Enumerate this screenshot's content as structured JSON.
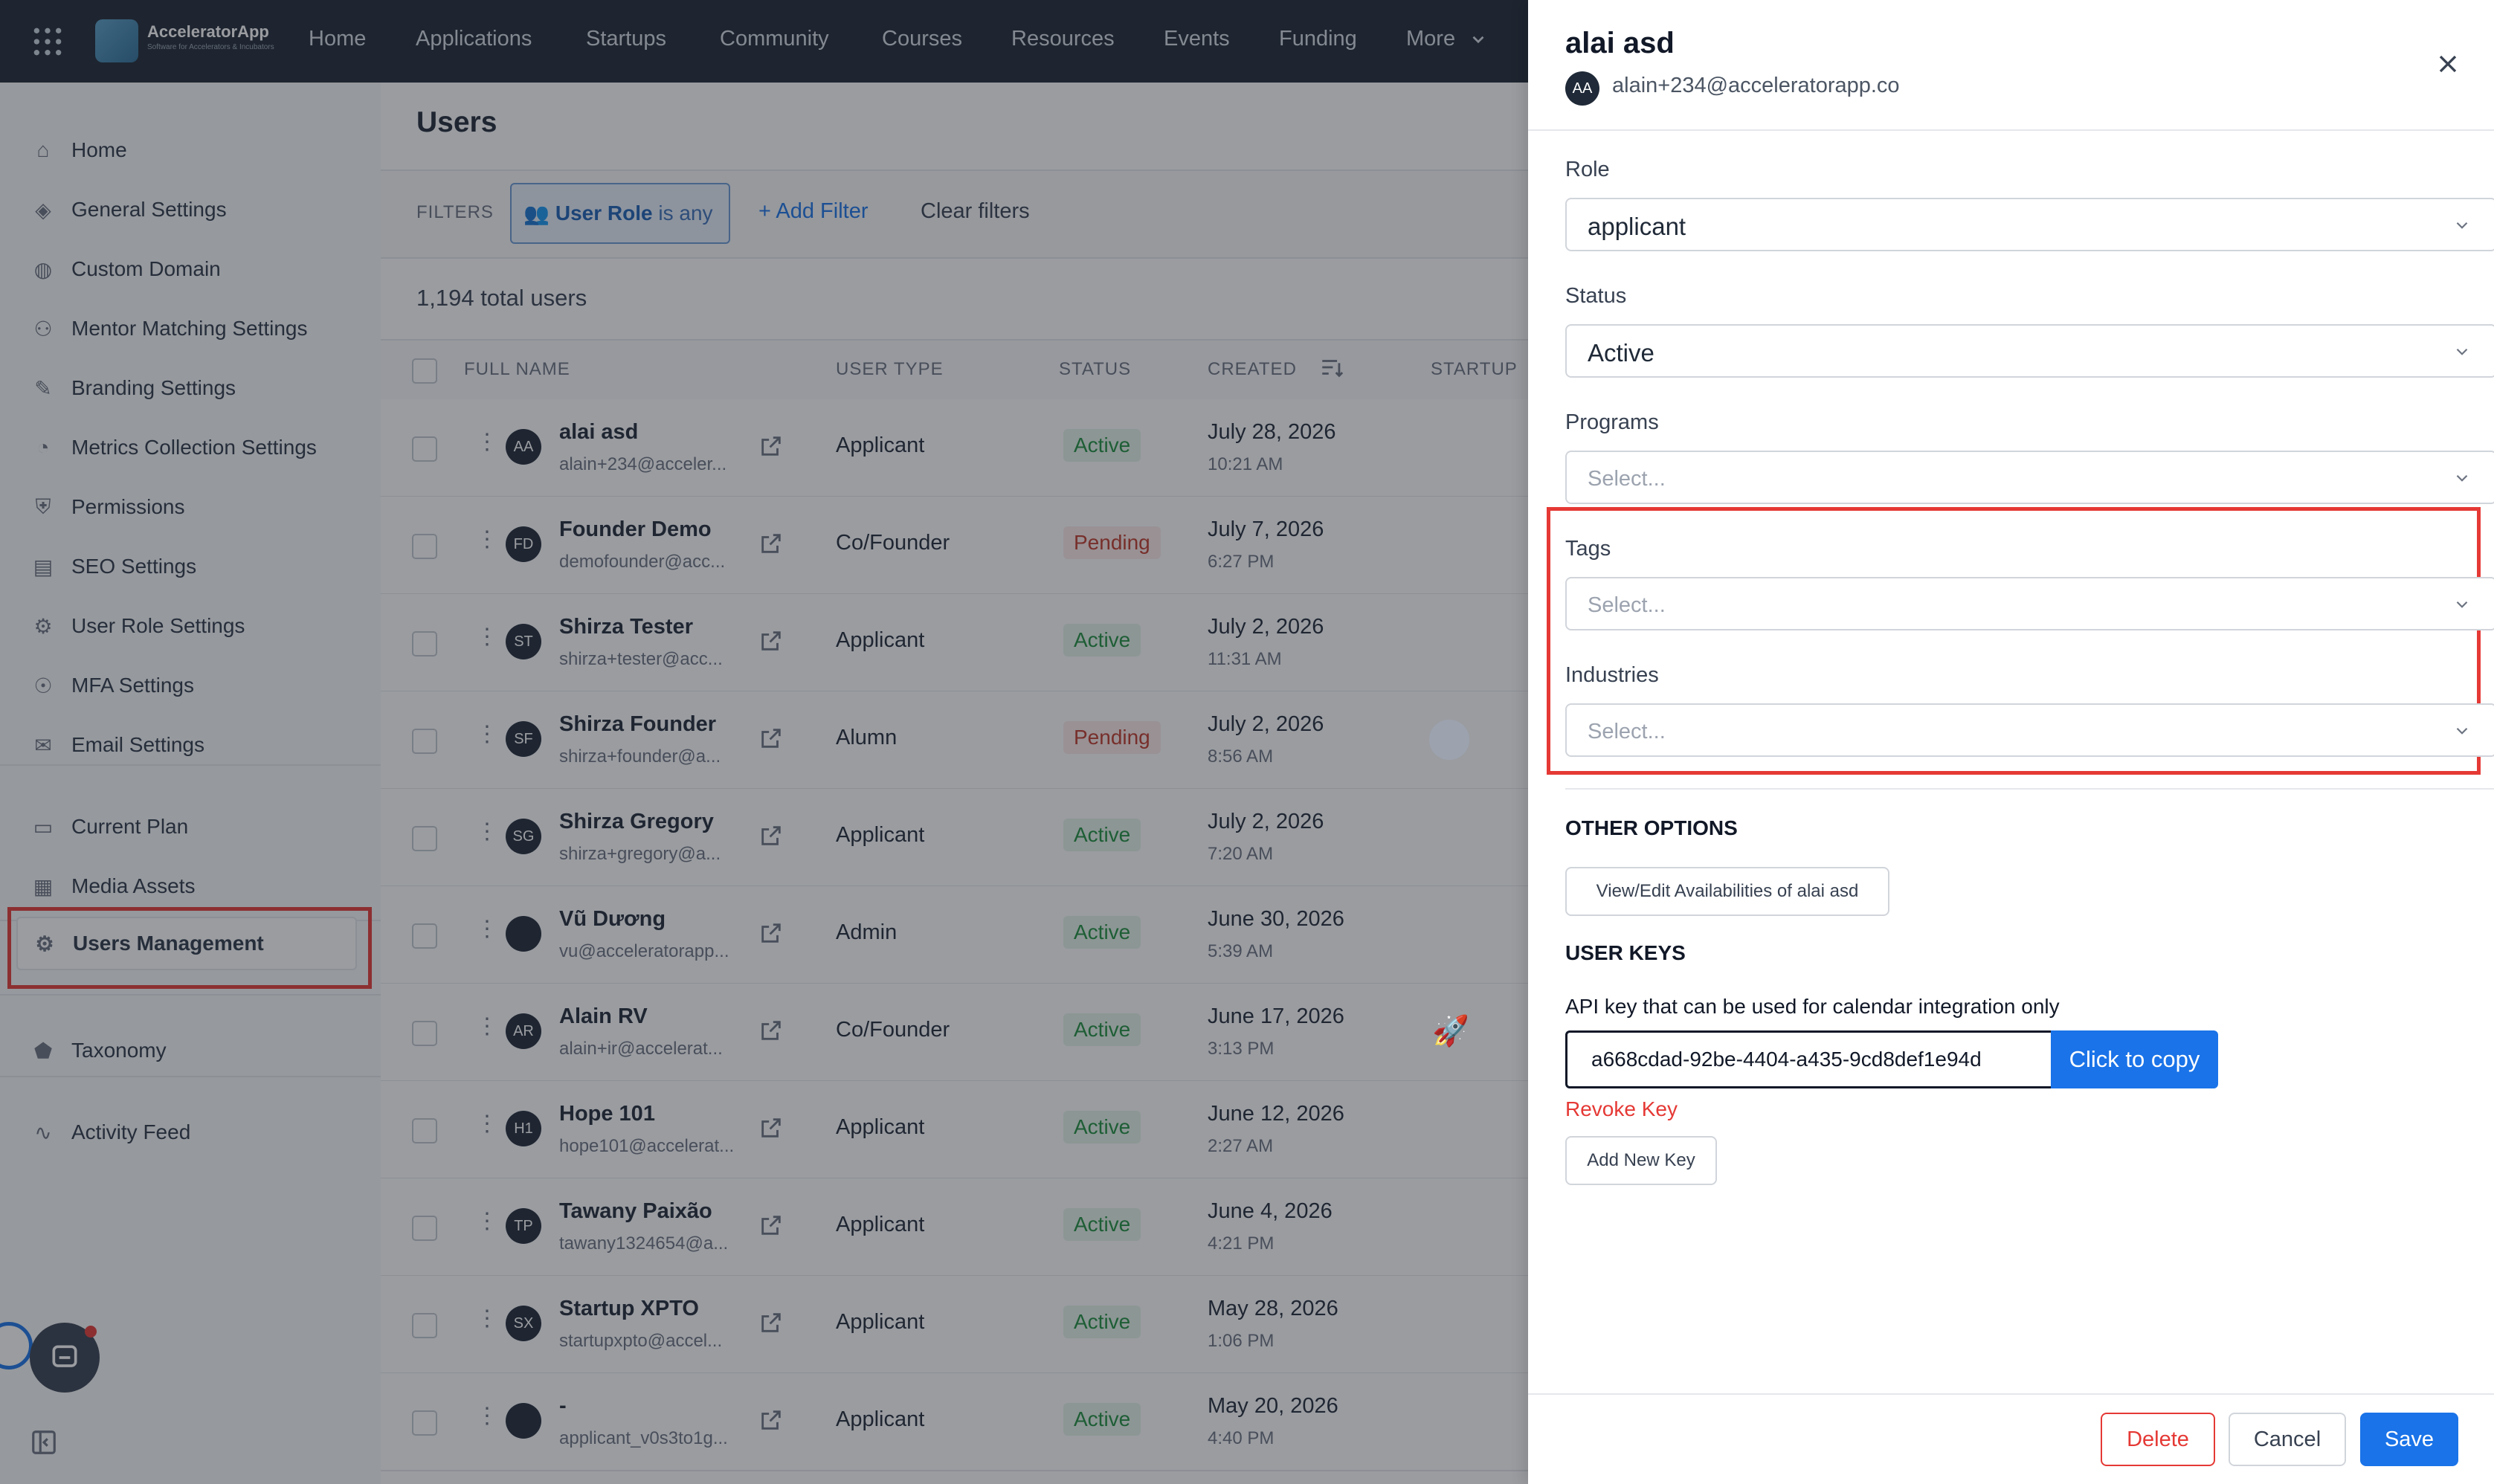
{
  "topnav": {
    "brand": "AcceleratorApp",
    "brand_sub": "Software for Accelerators & Incubators",
    "items": [
      "Home",
      "Applications",
      "Startups",
      "Community",
      "Courses",
      "Resources",
      "Events",
      "Funding",
      "More"
    ]
  },
  "sidebar": {
    "items": [
      {
        "label": "Home",
        "icon": "home-icon"
      },
      {
        "label": "General Settings",
        "icon": "cube-icon"
      },
      {
        "label": "Custom Domain",
        "icon": "globe-icon"
      },
      {
        "label": "Mentor Matching Settings",
        "icon": "users-icon"
      },
      {
        "label": "Branding Settings",
        "icon": "brush-icon"
      },
      {
        "label": "Metrics Collection Settings",
        "icon": "pie-chart-icon"
      },
      {
        "label": "Permissions",
        "icon": "shield-icon"
      },
      {
        "label": "SEO Settings",
        "icon": "seo-icon"
      },
      {
        "label": "User Role Settings",
        "icon": "user-gear-icon"
      },
      {
        "label": "MFA Settings",
        "icon": "fingerprint-icon"
      },
      {
        "label": "Email Settings",
        "icon": "mail-icon"
      },
      {
        "label": "Current Plan",
        "icon": "card-icon"
      },
      {
        "label": "Media Assets",
        "icon": "media-icon"
      },
      {
        "label": "Users Management",
        "icon": "user-gear-icon"
      },
      {
        "label": "Taxonomy",
        "icon": "tag-icon"
      },
      {
        "label": "Activity Feed",
        "icon": "activity-icon"
      }
    ]
  },
  "main": {
    "title": "Users",
    "filters_label": "FILTERS",
    "filter_chip_strong": "User Role",
    "filter_chip_rest": " is any",
    "add_filter": "+ Add Filter",
    "clear_filters": "Clear filters",
    "total": "1,194 total users",
    "columns": [
      "FULL NAME",
      "USER TYPE",
      "STATUS",
      "CREATED",
      "STARTUP"
    ],
    "rows": [
      {
        "initials": "AA",
        "name": "alai asd",
        "email": "alain+234@acceler...",
        "type": "Applicant",
        "status": "Active",
        "date": "July 28, 2026",
        "time": "10:21 AM"
      },
      {
        "initials": "FD",
        "name": "Founder Demo",
        "email": "demofounder@acc...",
        "type": "Co/Founder",
        "status": "Pending",
        "date": "July 7, 2026",
        "time": "6:27 PM"
      },
      {
        "initials": "ST",
        "name": "Shirza Tester",
        "email": "shirza+tester@acc...",
        "type": "Applicant",
        "status": "Active",
        "date": "July 2, 2026",
        "time": "11:31 AM"
      },
      {
        "initials": "SF",
        "name": "Shirza Founder",
        "email": "shirza+founder@a...",
        "type": "Alumn",
        "status": "Pending",
        "date": "July 2, 2026",
        "time": "8:56 AM"
      },
      {
        "initials": "SG",
        "name": "Shirza Gregory",
        "email": "shirza+gregory@a...",
        "type": "Applicant",
        "status": "Active",
        "date": "July 2, 2026",
        "time": "7:20 AM"
      },
      {
        "initials": "",
        "name": "Vũ Dương",
        "email": "vu@acceleratorapp...",
        "type": "Admin",
        "status": "Active",
        "date": "June 30, 2026",
        "time": "5:39 AM"
      },
      {
        "initials": "AR",
        "name": "Alain RV",
        "email": "alain+ir@accelerat...",
        "type": "Co/Founder",
        "status": "Active",
        "date": "June 17, 2026",
        "time": "3:13 PM"
      },
      {
        "initials": "H1",
        "name": "Hope 101",
        "email": "hope101@accelerat...",
        "type": "Applicant",
        "status": "Active",
        "date": "June 12, 2026",
        "time": "2:27 AM"
      },
      {
        "initials": "TP",
        "name": "Tawany Paixão",
        "email": "tawany1324654@a...",
        "type": "Applicant",
        "status": "Active",
        "date": "June 4, 2026",
        "time": "4:21 PM"
      },
      {
        "initials": "SX",
        "name": "Startup XPTO",
        "email": "startupxpto@accel...",
        "type": "Applicant",
        "status": "Active",
        "date": "May 28, 2026",
        "time": "1:06 PM"
      },
      {
        "initials": "",
        "name": "-",
        "email": "applicant_v0s3to1g...",
        "type": "Applicant",
        "status": "Active",
        "date": "May 20, 2026",
        "time": "4:40 PM"
      }
    ]
  },
  "drawer": {
    "name": "alai asd",
    "initials": "AA",
    "email": "alain+234@acceleratorapp.co",
    "role_label": "Role",
    "role_value": "applicant",
    "status_label": "Status",
    "status_value": "Active",
    "programs_label": "Programs",
    "tags_label": "Tags",
    "industries_label": "Industries",
    "select_placeholder": "Select...",
    "other_options": "OTHER OPTIONS",
    "view_edit": "View/Edit Availabilities of alai asd",
    "user_keys": "USER KEYS",
    "api_desc": "API key that can be used for calendar integration only",
    "api_key": "a668cdad-92be-4404-a435-9cd8def1e94d",
    "copy": "Click to copy",
    "revoke": "Revoke Key",
    "add_key": "Add New Key",
    "delete": "Delete",
    "cancel": "Cancel",
    "save": "Save"
  },
  "colors": {
    "accent": "#1a73e8",
    "danger": "#e53935",
    "nav_bg": "#1e2733",
    "active_green": "#1e8e3e",
    "pending_red": "#c0392b"
  }
}
